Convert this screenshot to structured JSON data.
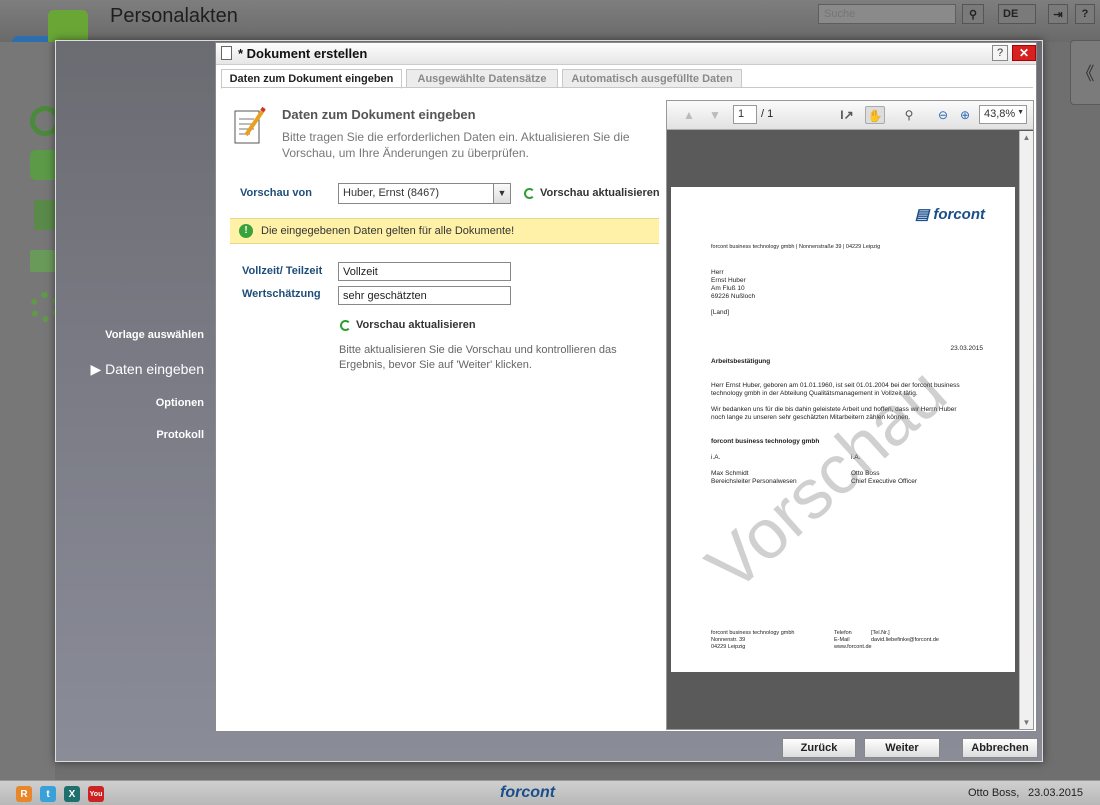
{
  "app": {
    "title": "Personalakten",
    "search_placeholder": "Suche",
    "language": "DE",
    "user": "Otto Boss,",
    "date": "23.03.2015",
    "footer_logo": "forcont"
  },
  "wizard": {
    "steps": [
      {
        "label": "Vorlage auswählen",
        "active": false
      },
      {
        "label": "▶ Daten eingeben",
        "active": true
      },
      {
        "label": "Optionen",
        "active": false
      },
      {
        "label": "Protokoll",
        "active": false
      }
    ]
  },
  "dialog": {
    "title": "* Dokument erstellen",
    "help_label": "?",
    "close_label": "✕",
    "tabs": [
      {
        "label": "Daten zum Dokument eingeben",
        "active": true
      },
      {
        "label": "Ausgewählte Datensätze",
        "active": false
      },
      {
        "label": "Automatisch ausgefüllte Daten",
        "active": false
      }
    ],
    "form": {
      "heading": "Daten zum Dokument eingeben",
      "description": "Bitte tragen Sie die erforderlichen Daten ein. Aktualisieren Sie die Vorschau, um Ihre Änderungen zu überprüfen.",
      "preview_of_label": "Vorschau von",
      "preview_of_value": "Huber, Ernst (8467)",
      "refresh_label": "Vorschau aktualisieren",
      "info_text": "Die eingegebenen Daten gelten für alle Dokumente!",
      "fields": [
        {
          "label": "Vollzeit/ Teilzeit",
          "value": "Vollzeit"
        },
        {
          "label": "Wertschätzung",
          "value": "sehr geschätzten"
        }
      ],
      "refresh_label_2": "Vorschau aktualisieren",
      "hint": "Bitte aktualisieren Sie die Vorschau und kontrollieren das Ergebnis, bevor Sie auf 'Weiter' klicken."
    },
    "preview": {
      "page_number": "1",
      "page_total": "/ 1",
      "zoom": "43,8%",
      "watermark": "Vorschau",
      "letter": {
        "logo": "forcont",
        "sender_line": "forcont business technology gmbh | Nonnenstraße 39 | 04229 Leipzig",
        "address": [
          "Herr",
          "Ernst Huber",
          "Am Fluß 10",
          "69226 Nußloch"
        ],
        "country": "[Land]",
        "date": "23.03.2015",
        "subject": "Arbeitsbestätigung",
        "body1": [
          "Herr Ernst Huber, geboren am 01.01.1960, ist seit 01.01.2004 bei der forcont business",
          "technology gmbh in der Abteilung Qualitätsmanagement in Vollzeit tätig."
        ],
        "body2": [
          "Wir bedanken uns für die bis dahin geleistete Arbeit und hoffen, dass wir Herrn Huber",
          "noch lange zu unseren sehr geschätzten Mitarbeitern zählen können."
        ],
        "company": "forcont business technology gmbh",
        "ia_left": "i.A.",
        "ia_right": "i.A.",
        "signer_left": [
          "Max Schmidt",
          "Bereichsleiter Personalwesen"
        ],
        "signer_right": [
          "Otto Boss",
          "Chief Executive Officer"
        ],
        "footer_col1": [
          "forcont business technology gmbh",
          "Nonnenstr. 39",
          "04229 Leipzig"
        ],
        "footer_col2": [
          "Telefon",
          "E-Mail",
          "www.forcont.de"
        ],
        "footer_col3": [
          "[Tel.Nr.]",
          "david.liebefinke@forcont.de"
        ]
      }
    },
    "buttons": {
      "back": "Zurück",
      "next": "Weiter",
      "cancel": "Abbrechen"
    }
  },
  "colors": {
    "accent_blue": "#1f4d7a",
    "close_red": "#d82020",
    "info_yellow": "#fff2a8",
    "refresh_green": "#2e9e2e"
  }
}
